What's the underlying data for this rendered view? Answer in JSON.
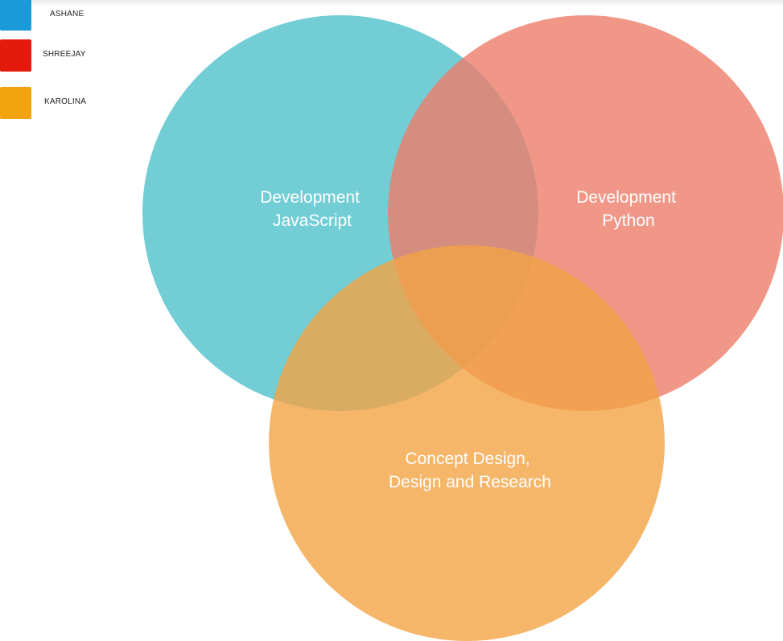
{
  "legend": [
    {
      "label": "ASHANE",
      "color": "#1b9ad9"
    },
    {
      "label": "SHREEJAY",
      "color": "#e41a0c"
    },
    {
      "label": "KAROLINA",
      "color": "#f2a40f"
    }
  ],
  "venn": {
    "sets": [
      {
        "lines": [
          "Development",
          "JavaScript"
        ],
        "color": "#4fc0c9"
      },
      {
        "lines": [
          "Development",
          "Python"
        ],
        "color": "#ee7d6a"
      },
      {
        "lines": [
          "Concept Design,",
          "Design and Research"
        ],
        "color": "#f3a445"
      }
    ]
  }
}
